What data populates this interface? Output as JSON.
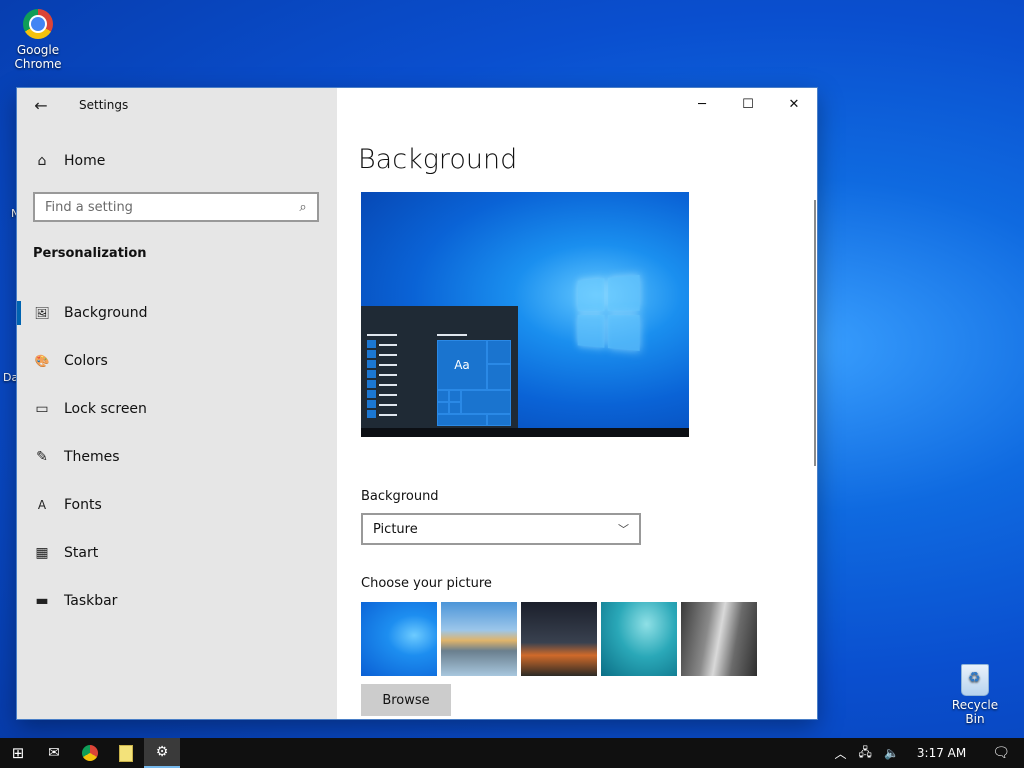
{
  "desktop": {
    "chrome_label": "Google Chrome",
    "recycle_label": "Recycle Bin",
    "peek_left_1": "N",
    "peek_left_2": "Da"
  },
  "window": {
    "app_title": "Settings",
    "back_icon": "arrow-left-icon",
    "controls": {
      "minimize": "─",
      "maximize": "☐",
      "close": "✕"
    }
  },
  "sidebar": {
    "home_label": "Home",
    "search_placeholder": "Find a setting",
    "section_title": "Personalization",
    "items": [
      {
        "label": "Background",
        "icon": "picture-icon",
        "glyph": "🖼"
      },
      {
        "label": "Colors",
        "icon": "palette-icon",
        "glyph": "🎨"
      },
      {
        "label": "Lock screen",
        "icon": "lock-screen-icon",
        "glyph": "▭"
      },
      {
        "label": "Themes",
        "icon": "brush-icon",
        "glyph": "✎"
      },
      {
        "label": "Fonts",
        "icon": "font-icon",
        "glyph": "A"
      },
      {
        "label": "Start",
        "icon": "start-icon",
        "glyph": "▦"
      },
      {
        "label": "Taskbar",
        "icon": "taskbar-icon",
        "glyph": "▬"
      }
    ]
  },
  "main": {
    "title": "Background",
    "preview_tile_text": "Aa",
    "background_label": "Background",
    "background_value": "Picture",
    "choose_label": "Choose your picture",
    "browse_label": "Browse"
  },
  "taskbar": {
    "time": "3:17 AM"
  },
  "colors": {
    "accent": "#0063b1",
    "sidebar_bg": "#e6e6e6",
    "taskbar_bg": "#101010"
  }
}
